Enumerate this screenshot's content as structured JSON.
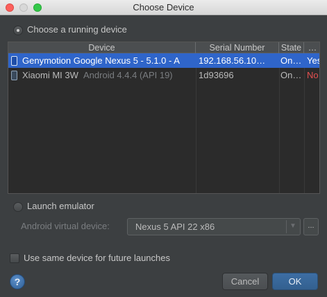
{
  "window": {
    "title": "Choose Device"
  },
  "running": {
    "label": "Choose a running device",
    "checked": true
  },
  "table": {
    "columns": [
      "Device",
      "Serial Number",
      "State",
      "…"
    ],
    "rows": [
      {
        "device": "Genymotion Google Nexus 5 - 5.1.0 - A",
        "device_extra": "",
        "serial": "192.168.56.10…",
        "state": "On…",
        "compat": "Yes",
        "selected": true
      },
      {
        "device": "Xiaomi MI 3W",
        "device_extra": "Android 4.4.4 (API 19)",
        "serial": "1d93696",
        "state": "On…",
        "compat": "No",
        "selected": false
      }
    ]
  },
  "emulator": {
    "label": "Launch emulator",
    "field_label": "Android virtual device:",
    "selected_avd": "Nexus 5 API 22 x86",
    "more_label": "..."
  },
  "same_device": {
    "label": "Use same device for future launches",
    "checked": false
  },
  "buttons": {
    "help": "?",
    "cancel": "Cancel",
    "ok": "OK"
  },
  "colors": {
    "selection": "#2f65ca",
    "incompatible": "#e45050",
    "ok_button": "#3d6ea4"
  }
}
